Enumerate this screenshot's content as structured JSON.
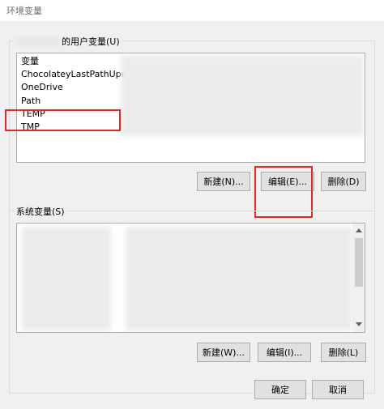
{
  "window": {
    "title": "环境变量"
  },
  "user_section": {
    "label": "的用户变量(U)",
    "variables": [
      "变量",
      "ChocolateyLastPathUpdate",
      "OneDrive",
      "Path",
      "TEMP",
      "TMP"
    ],
    "buttons": {
      "new": "新建(N)...",
      "edit": "编辑(E)...",
      "delete": "删除(D)"
    }
  },
  "system_section": {
    "label": "系统变量(S)",
    "buttons": {
      "new": "新建(W)...",
      "edit": "编辑(I)...",
      "delete": "删除(L)"
    }
  },
  "footer": {
    "ok": "确定",
    "cancel": "取消"
  },
  "colors": {
    "highlight": "#e0292b",
    "button_face": "#e1e1e1",
    "window_bg": "#f0f0f0"
  }
}
